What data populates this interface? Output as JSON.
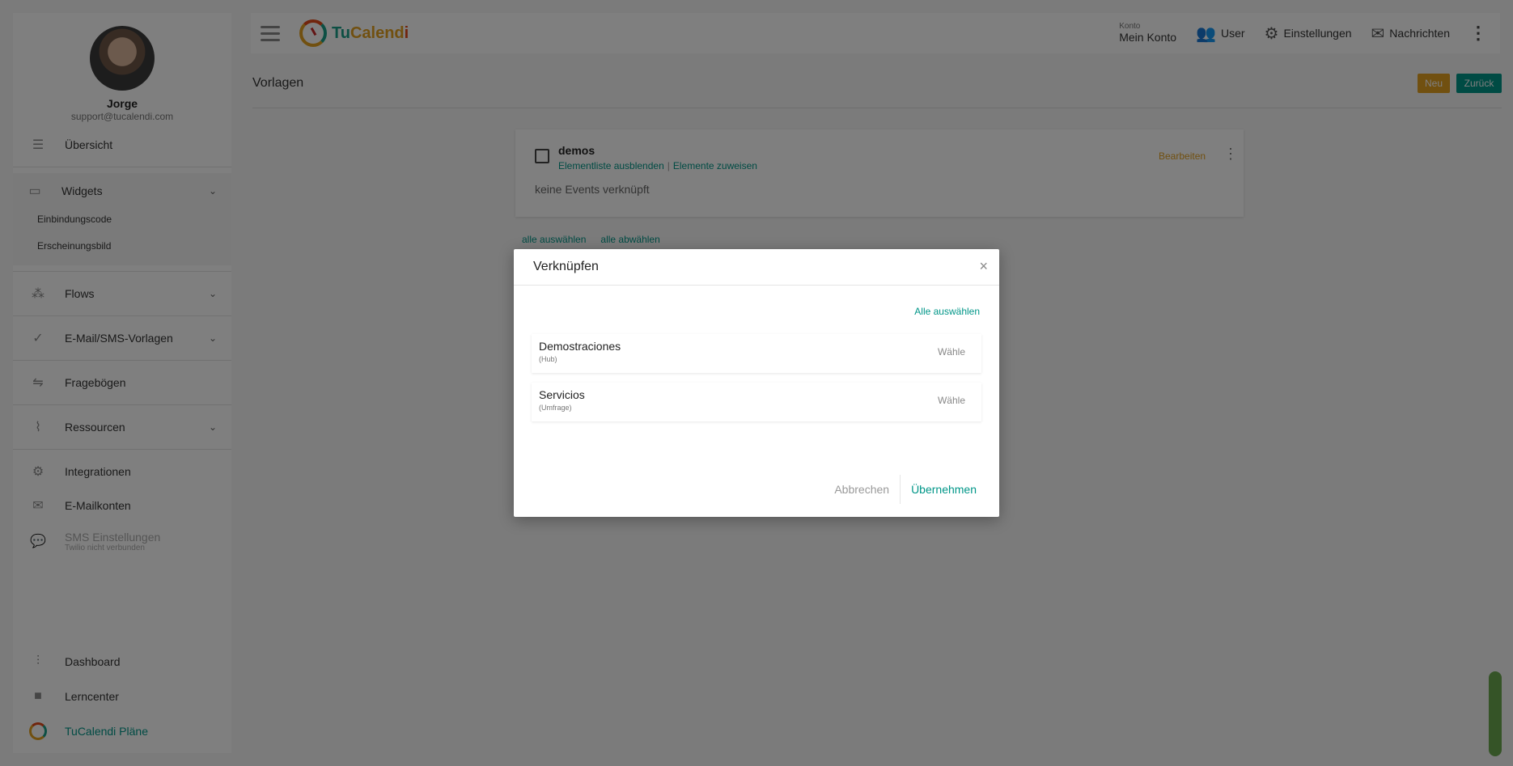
{
  "sidebar": {
    "profile": {
      "name": "Jorge",
      "email": "support@tucalendi.com"
    },
    "items": {
      "overview": "Übersicht",
      "widgets": "Widgets",
      "widgets_sub": [
        "Einbindungscode",
        "Erscheinungsbild"
      ],
      "flows": "Flows",
      "email_sms": "E-Mail/SMS-Vorlagen",
      "forms": "Fragebögen",
      "resources": "Ressourcen",
      "integrations": "Integrationen",
      "email_accounts": "E-Mailkonten",
      "sms_settings": "SMS Einstellungen",
      "sms_note": "Twilio nicht verbunden",
      "dashboard": "Dashboard",
      "learn": "Lerncenter",
      "plans": "TuCalendi Pläne"
    }
  },
  "topbar": {
    "logo": {
      "tu": "Tu",
      "cal": "Calend",
      "i": "i"
    },
    "konto_label": "Konto",
    "konto_value": "Mein Konto",
    "user": "User",
    "settings": "Einstellungen",
    "messages": "Nachrichten"
  },
  "page": {
    "title": "Vorlagen",
    "new_button": "Neu",
    "back_button": "Zurück",
    "card": {
      "title": "demos",
      "link_hide": "Elementliste ausblenden",
      "link_sep": "|",
      "link_assign": "Elemente zuweisen",
      "edit": "Bearbeiten",
      "empty": "keine Events verknüpft"
    },
    "select_all": "alle auswählen",
    "deselect_all": "alle abwählen"
  },
  "modal": {
    "title": "Verknüpfen",
    "close": "×",
    "select_all": "Alle auswählen",
    "options": [
      {
        "name": "Demostraciones",
        "type": "(Hub)",
        "action": "Wähle"
      },
      {
        "name": "Servicios",
        "type": "(Umfrage)",
        "action": "Wähle"
      }
    ],
    "cancel": "Abbrechen",
    "apply": "Übernehmen"
  },
  "colors": {
    "accent": "#009688",
    "warning": "#e2a020",
    "overlay": "rgba(0,0,0,0.5)"
  }
}
